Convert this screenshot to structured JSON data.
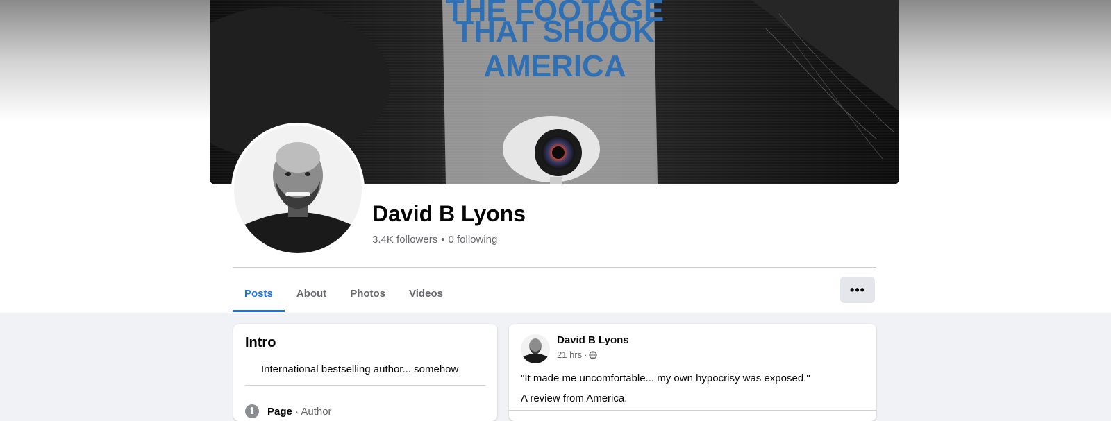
{
  "cover": {
    "title_lines": [
      "THE FOOTAGE",
      "THAT SHOOK",
      "AMERICA"
    ],
    "colors": {
      "title": "#2f6fb3",
      "background": "#111111"
    }
  },
  "profile": {
    "name": "David B Lyons",
    "followers": "3.4K followers",
    "separator": "•",
    "following": "0 following"
  },
  "tabs": [
    {
      "label": "Posts",
      "active": true
    },
    {
      "label": "About",
      "active": false
    },
    {
      "label": "Photos",
      "active": false
    },
    {
      "label": "Videos",
      "active": false
    }
  ],
  "more_button": {
    "label": "•••"
  },
  "intro": {
    "title": "Intro",
    "bio": "International bestselling author... somehow",
    "page_label": "Page",
    "page_type": " · Author",
    "info_icon": "i"
  },
  "post": {
    "author": "David B Lyons",
    "time": "21 hrs",
    "meta_separator": "·",
    "line1": "\"It made me uncomfortable... my own hypocrisy was exposed.\"",
    "line2": "A review from America."
  },
  "colors": {
    "accent": "#1b74e4",
    "page_background": "#f0f2f5",
    "secondary_text": "#65676b"
  }
}
